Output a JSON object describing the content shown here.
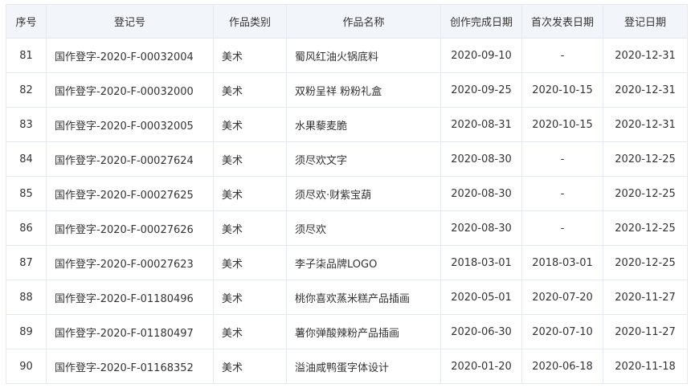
{
  "table": {
    "headers": [
      "序号",
      "登记号",
      "作品类别",
      "作品名称",
      "创作完成日期",
      "首次发表日期",
      "登记日期"
    ],
    "rows": [
      [
        "81",
        "国作登字-2020-F-00032004",
        "美术",
        "蜀风红油火锅底料",
        "2020-09-10",
        "-",
        "2020-12-31"
      ],
      [
        "82",
        "国作登字-2020-F-00032000",
        "美术",
        "双粉呈祥 粉粉礼盒",
        "2020-09-25",
        "2020-10-15",
        "2020-12-31"
      ],
      [
        "83",
        "国作登字-2020-F-00032005",
        "美术",
        "水果藜麦脆",
        "2020-08-31",
        "2020-10-15",
        "2020-12-31"
      ],
      [
        "84",
        "国作登字-2020-F-00027624",
        "美术",
        "须尽欢文字",
        "2020-08-30",
        "-",
        "2020-12-25"
      ],
      [
        "85",
        "国作登字-2020-F-00027625",
        "美术",
        "须尽欢·财紫宝葫",
        "2020-08-30",
        "-",
        "2020-12-25"
      ],
      [
        "86",
        "国作登字-2020-F-00027626",
        "美术",
        "须尽欢",
        "2020-08-30",
        "-",
        "2020-12-25"
      ],
      [
        "87",
        "国作登字-2020-F-00027623",
        "美术",
        "李子柒品牌LOGO",
        "2018-03-01",
        "2018-03-01",
        "2020-12-25"
      ],
      [
        "88",
        "国作登字-2020-F-01180496",
        "美术",
        "桃你喜欢蒸米糕产品插画",
        "2020-05-01",
        "2020-07-20",
        "2020-11-27"
      ],
      [
        "89",
        "国作登字-2020-F-01180497",
        "美术",
        "薯你弹酸辣粉产品插画",
        "2020-06-30",
        "2020-07-10",
        "2020-11-27"
      ],
      [
        "90",
        "国作登字-2020-F-01168352",
        "美术",
        "溢油咸鸭蛋字体设计",
        "2020-01-20",
        "2020-06-18",
        "2020-11-18"
      ]
    ]
  }
}
